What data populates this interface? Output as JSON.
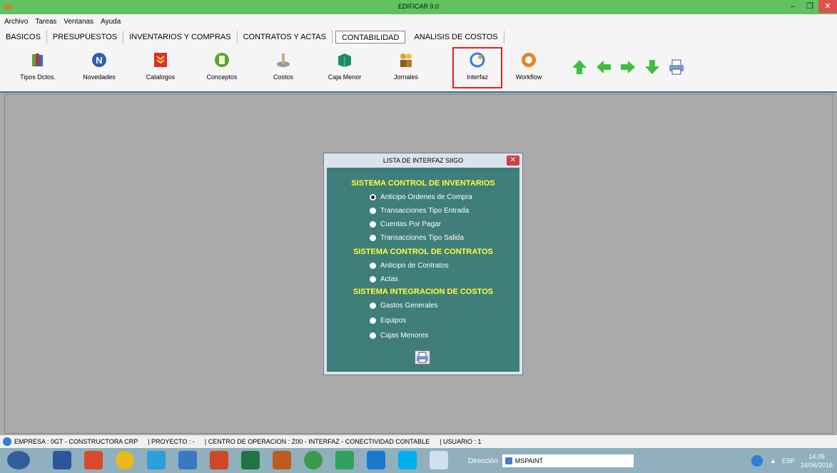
{
  "window": {
    "title": "EDIFICAR 9.0",
    "min": "–",
    "max": "❐",
    "close": "✕"
  },
  "menu": [
    "Archivo",
    "Tareas",
    "Ventanas",
    "Ayuda"
  ],
  "tabs": [
    {
      "label": "BASICOS"
    },
    {
      "label": "PRESUPUESTOS"
    },
    {
      "label": "INVENTARIOS Y COMPRAS"
    },
    {
      "label": "CONTRATOS Y ACTAS"
    },
    {
      "label": "CONTABILIDAD",
      "active": true
    },
    {
      "label": "ANALISIS DE COSTOS"
    }
  ],
  "toolbar": {
    "buttons": [
      {
        "label": "Tipos Dctos.",
        "icon": "books-icon"
      },
      {
        "label": "Novedades",
        "icon": "n-circle-icon"
      },
      {
        "label": "Catalogos",
        "icon": "catalog-icon"
      },
      {
        "label": "Conceptos",
        "icon": "concepts-icon"
      },
      {
        "label": "Costos",
        "icon": "costs-icon"
      },
      {
        "label": "Caja Menor",
        "icon": "cash-box-icon"
      },
      {
        "label": "Jornales",
        "icon": "workers-icon"
      },
      {
        "label": "Interfaz",
        "icon": "interface-icon",
        "highlighted": true
      },
      {
        "label": "Workflow",
        "icon": "workflow-icon"
      }
    ],
    "nav": [
      "arrow-up-icon",
      "arrow-left-icon",
      "arrow-right-icon",
      "arrow-down-icon",
      "printer-icon"
    ]
  },
  "dialog": {
    "title": "LISTA DE INTERFAZ SIIGO",
    "close": "✕",
    "sections": [
      {
        "heading": "SISTEMA CONTROL DE INVENTARIOS",
        "options": [
          {
            "label": "Anticipo Ordenes de Compra",
            "selected": true
          },
          {
            "label": "Transacciones Tipo Entrada",
            "selected": false
          },
          {
            "label": "Cuentas Por Pagar",
            "selected": false
          },
          {
            "label": "Transacciones Tipo Salida",
            "selected": false
          }
        ]
      },
      {
        "heading": "SISTEMA CONTROL DE CONTRATOS",
        "options": [
          {
            "label": "Anticipo de Contratos",
            "selected": false
          },
          {
            "label": "Actas",
            "selected": false
          }
        ]
      },
      {
        "heading": "SISTEMA INTEGRACION DE COSTOS",
        "options": [
          {
            "label": "Gastos Generales",
            "selected": false
          },
          {
            "label": "Equipos",
            "selected": false
          },
          {
            "label": "Cajas Menores",
            "selected": false
          }
        ]
      }
    ]
  },
  "status": {
    "empresa": "EMPRESA : 0GT - CONSTRUCTORA CRP",
    "proyecto": "| PROYECTO : -",
    "centro": "| CENTRO DE OPERACION : Z00 - INTERFAZ - CONECTIVIDAD CONTABLE",
    "usuario": "| USUARIO : 1"
  },
  "taskbar": {
    "address_label": "Dirección",
    "address_value": "MSPAINT",
    "language": "ESP",
    "time": "14.09",
    "date": "24/06/2016"
  },
  "colors": {
    "titlebar": "#5fc15f",
    "dialog_body": "#3f7e7a",
    "section_heading": "#ffff33",
    "highlight_border": "#e02020"
  }
}
